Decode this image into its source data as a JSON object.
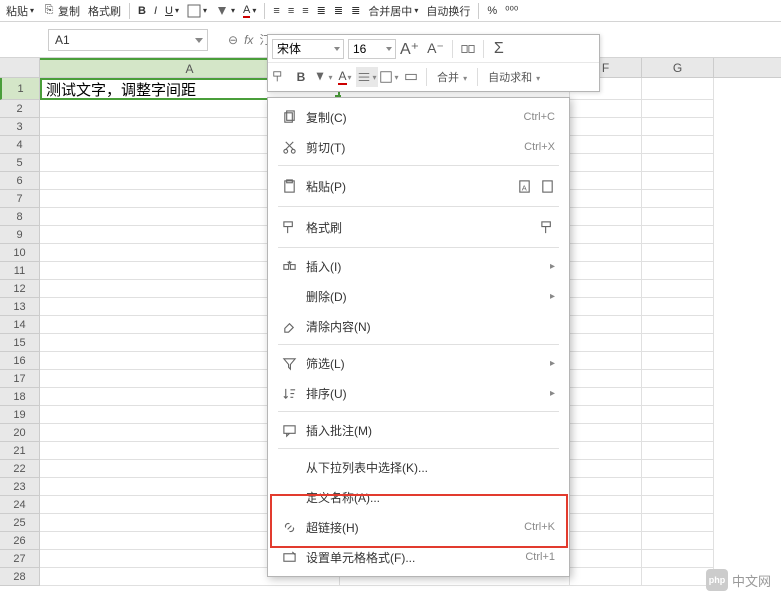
{
  "top_toolbar": {
    "paste": "粘贴",
    "copy": "复制",
    "format_painter": "格式刷",
    "merge_center": "合并居中",
    "wrap_text": "自动换行"
  },
  "cell_reference": "A1",
  "formula_prefix": "汀",
  "float_toolbar": {
    "font_name": "宋体",
    "font_size": "16",
    "merge": "合并",
    "autosum": "自动求和"
  },
  "columns": [
    "A",
    "F",
    "G"
  ],
  "cell_a1_text": "测试文字，调整字间距",
  "rows": [
    "1",
    "2",
    "3",
    "4",
    "5",
    "6",
    "7",
    "8",
    "9",
    "10",
    "11",
    "12",
    "13",
    "14",
    "15",
    "16",
    "17",
    "18",
    "19",
    "20",
    "21",
    "22",
    "23",
    "24",
    "25",
    "26",
    "27",
    "28"
  ],
  "context_menu": {
    "copy": {
      "label": "复制(C)",
      "shortcut": "Ctrl+C"
    },
    "cut": {
      "label": "剪切(T)",
      "shortcut": "Ctrl+X"
    },
    "paste": {
      "label": "粘贴(P)"
    },
    "format_painter": {
      "label": "格式刷"
    },
    "insert": {
      "label": "插入(I)"
    },
    "delete": {
      "label": "删除(D)"
    },
    "clear": {
      "label": "清除内容(N)"
    },
    "filter": {
      "label": "筛选(L)"
    },
    "sort": {
      "label": "排序(U)"
    },
    "insert_comment": {
      "label": "插入批注(M)"
    },
    "pick_from_list": {
      "label": "从下拉列表中选择(K)..."
    },
    "define_name": {
      "label": "定义名称(A)..."
    },
    "hyperlink": {
      "label": "超链接(H)",
      "shortcut": "Ctrl+K"
    },
    "format_cells": {
      "label": "设置单元格格式(F)...",
      "shortcut": "Ctrl+1"
    }
  },
  "watermark": "中文网",
  "watermark_logo": "php"
}
